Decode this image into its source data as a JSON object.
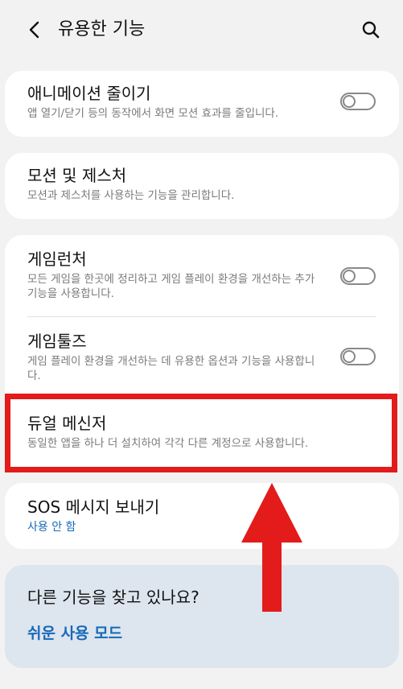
{
  "header": {
    "title": "유용한 기능",
    "back_icon": "chevron-left-icon",
    "search_icon": "search-icon"
  },
  "cards": {
    "animation": {
      "title": "애니메이션 줄이기",
      "subtitle": "앱 열기/닫기 등의 동작에서 화면 모션 효과를 줄입니다.",
      "toggle_on": false
    },
    "motion": {
      "title": "모션 및 제스처",
      "subtitle": "모션과 제스처를 사용하는 기능을 관리합니다."
    },
    "game_launcher": {
      "title": "게임런처",
      "subtitle": "모든 게임을 한곳에 정리하고 게임 플레이 환경을 개선하는 추가 기능을 사용합니다.",
      "toggle_on": false
    },
    "game_tools": {
      "title": "게임툴즈",
      "subtitle": "게임 플레이 환경을 개선하는 데 유용한 옵션과 기능을 사용합니다.",
      "toggle_on": false
    },
    "dual_messenger": {
      "title": "듀얼 메신저",
      "subtitle": "동일한 앱을 하나 더 설치하여 각각 다른 계정으로 사용합니다."
    },
    "sos": {
      "title": "SOS 메시지 보내기",
      "status": "사용 안 함"
    },
    "looking": {
      "question": "다른 기능을 찾고 있나요?",
      "link": "쉬운 사용 모드"
    }
  },
  "annotation": {
    "highlight_color": "#e31b1b",
    "arrow_color": "#e31b1b"
  }
}
